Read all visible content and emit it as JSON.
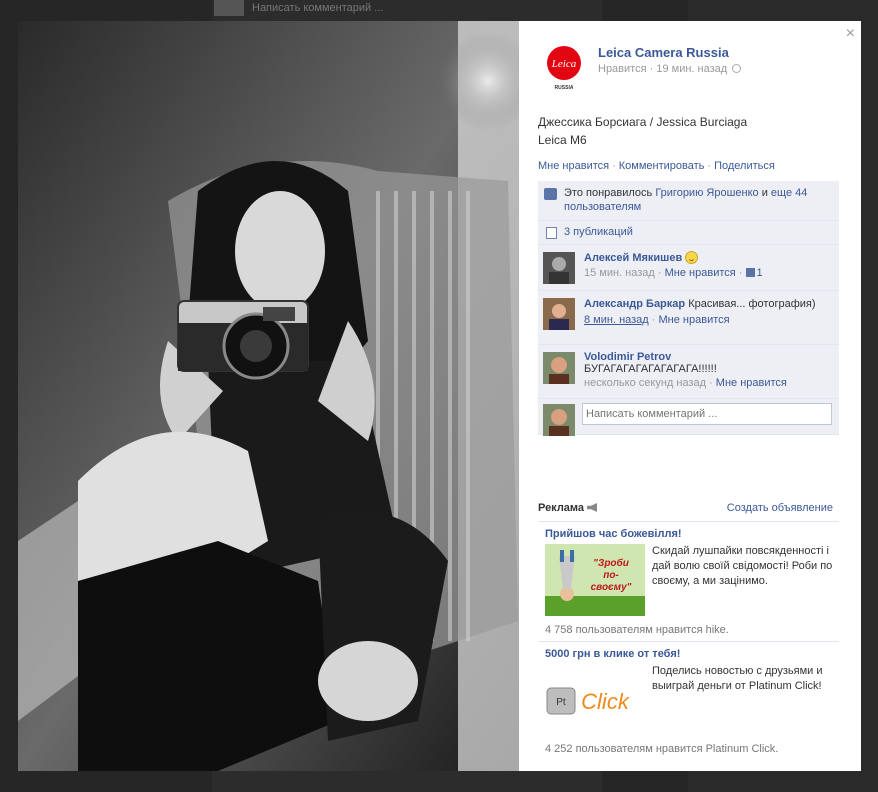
{
  "background": {
    "top_comment_placeholder": "Написать комментарий ..."
  },
  "post": {
    "page_name": "Leica Camera Russia",
    "logo_text": "Leica",
    "logo_sub": "RUSSIA",
    "meta_like": "Нравится",
    "meta_time": "19 мин. назад",
    "caption_line1": "Джессика Борсиага / Jessica Burciaga",
    "caption_line2": "Leica M6",
    "actions": {
      "like": "Мне нравится",
      "comment": "Комментировать",
      "share": "Поделиться"
    },
    "likes_text_prefix": "Это понравилось",
    "likes_name": "Григорию Ярошенко",
    "likes_and": "и",
    "likes_others": "еще 44 пользователям",
    "publications": "3 публикаций",
    "comments": [
      {
        "author": "Алексей Мякишев",
        "text": "",
        "time": "15 мин. назад",
        "like_label": "Мне нравится",
        "like_count": "1"
      },
      {
        "author": "Александр Баркар",
        "text": "Красивая... фотография)",
        "time": "8 мин. назад",
        "like_label": "Мне нравится"
      },
      {
        "author": "Volodimir Petrov",
        "text": "БУГАГАГАГАГАГАГАГА!!!!!!",
        "time": "несколько секунд назад",
        "like_label": "Мне нравится"
      }
    ],
    "write_placeholder": "Написать комментарий ..."
  },
  "ads": {
    "title": "Реклама",
    "create": "Создать объявление",
    "items": [
      {
        "title": "Прийшов час божевілля!",
        "image_text": "\"Зроби по-своєму\"",
        "text": "Скидай лушпайки повсякденності і дай волю своїй свідомості! Роби по своєму, а ми зацінимо.",
        "likes": "4 758 пользователям нравится hike."
      },
      {
        "title": "5000 грн в клике от тебя!",
        "image_text": "Click",
        "image_badge": "Pt",
        "text": "Поделись новостью с друзьями и выиграй деньги от Platinum Click!",
        "likes": "4 252 пользователям нравится Platinum Click."
      }
    ]
  },
  "colors": {
    "link": "#3b5998",
    "ufi_bg": "#edeff4",
    "leica_red": "#e20613"
  }
}
